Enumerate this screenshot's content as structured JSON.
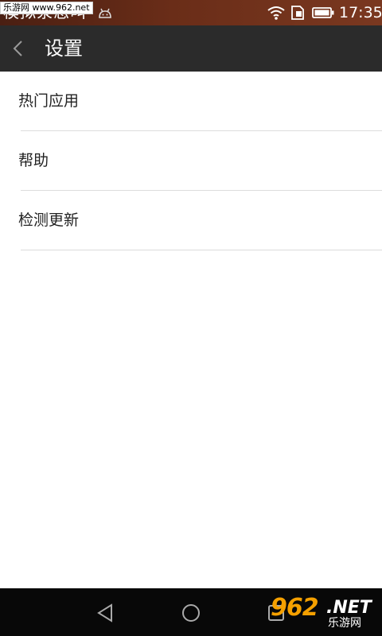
{
  "status_bar": {
    "title": "模拟泵怎叫",
    "time": "17:35",
    "watermark": "乐游网 www.962.net"
  },
  "app_bar": {
    "title": "设置"
  },
  "settings": {
    "items": [
      {
        "label": "热门应用"
      },
      {
        "label": "帮助"
      },
      {
        "label": "检测更新"
      }
    ]
  },
  "watermark": {
    "big": "962",
    "net": ".NET",
    "cn": "乐游网"
  },
  "colors": {
    "status_bar": "#6a2d18",
    "app_bar": "#2b2b2b",
    "nav_bar": "#080808",
    "divider": "#dcdcdc"
  }
}
